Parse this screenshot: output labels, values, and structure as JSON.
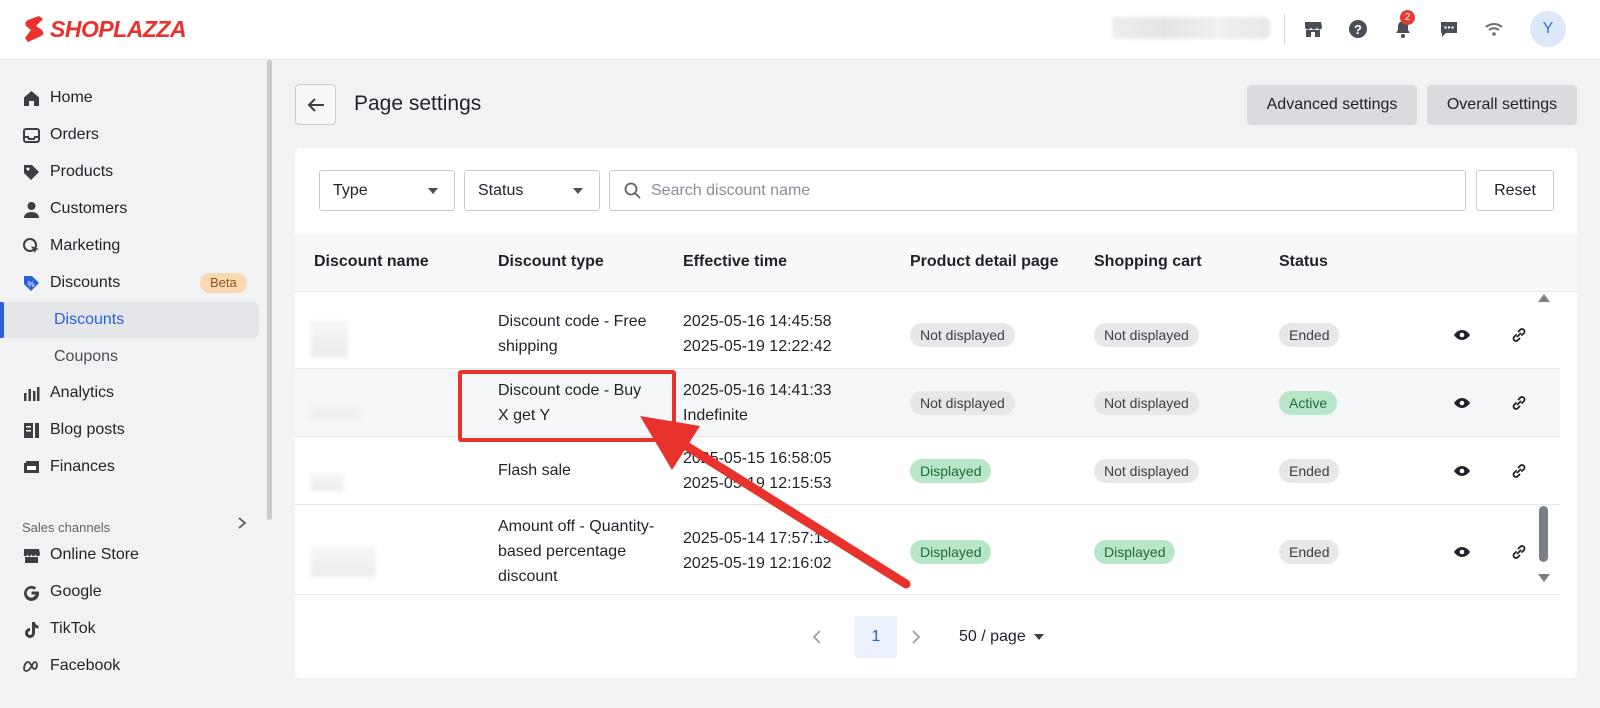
{
  "app": {
    "brand": "SHOPLAZZA",
    "brand_color": "#e8322b",
    "accent": "#2b5fd9"
  },
  "topbar": {
    "notifications_count": "2",
    "avatar_initial": "Y"
  },
  "sidebar": {
    "items": [
      {
        "label": "Home",
        "icon": "home-icon"
      },
      {
        "label": "Orders",
        "icon": "inbox-icon"
      },
      {
        "label": "Products",
        "icon": "tag-icon"
      },
      {
        "label": "Customers",
        "icon": "person-icon"
      },
      {
        "label": "Marketing",
        "icon": "cursor-icon"
      },
      {
        "label": "Discounts",
        "icon": "discount-tag-icon",
        "badge": "Beta"
      },
      {
        "label": "Analytics",
        "icon": "bar-chart-icon"
      },
      {
        "label": "Blog posts",
        "icon": "blog-icon"
      },
      {
        "label": "Finances",
        "icon": "finance-icon"
      }
    ],
    "subitems": {
      "discounts": "Discounts",
      "coupons": "Coupons"
    },
    "sales_channels_label": "Sales channels",
    "channels": [
      {
        "label": "Online Store",
        "icon": "store-icon"
      },
      {
        "label": "Google",
        "icon": "google-icon"
      },
      {
        "label": "TikTok",
        "icon": "tiktok-icon"
      },
      {
        "label": "Facebook",
        "icon": "meta-icon"
      }
    ]
  },
  "header": {
    "title": "Page settings",
    "advanced_btn": "Advanced settings",
    "overall_btn": "Overall settings"
  },
  "filters": {
    "type": "Type",
    "status": "Status",
    "search_placeholder": "Search discount name",
    "reset": "Reset"
  },
  "table": {
    "columns": [
      "Discount name",
      "Discount type",
      "Effective time",
      "Product detail page",
      "Shopping cart",
      "Status"
    ],
    "rows": [
      {
        "type": "Discount code - Free shipping",
        "start": "2025-05-16 14:45:58",
        "end": "2025-05-19 12:22:42",
        "pdp": "Not displayed",
        "cart": "Not displayed",
        "status": "Ended"
      },
      {
        "type": "Discount code - Buy X get Y",
        "start": "2025-05-16 14:41:33",
        "end": "Indefinite",
        "pdp": "Not displayed",
        "cart": "Not displayed",
        "status": "Active"
      },
      {
        "type": "Flash sale",
        "start": "2025-05-15 16:58:05",
        "end": "2025-05-19 12:15:53",
        "pdp": "Displayed",
        "cart": "Not displayed",
        "status": "Ended"
      },
      {
        "type": "Amount off - Quantity-based percentage discount",
        "start": "2025-05-14 17:57:19",
        "end": "2025-05-19 12:16:02",
        "pdp": "Displayed",
        "cart": "Displayed",
        "status": "Ended"
      }
    ]
  },
  "pagination": {
    "current": "1",
    "page_size": "50 / page"
  }
}
